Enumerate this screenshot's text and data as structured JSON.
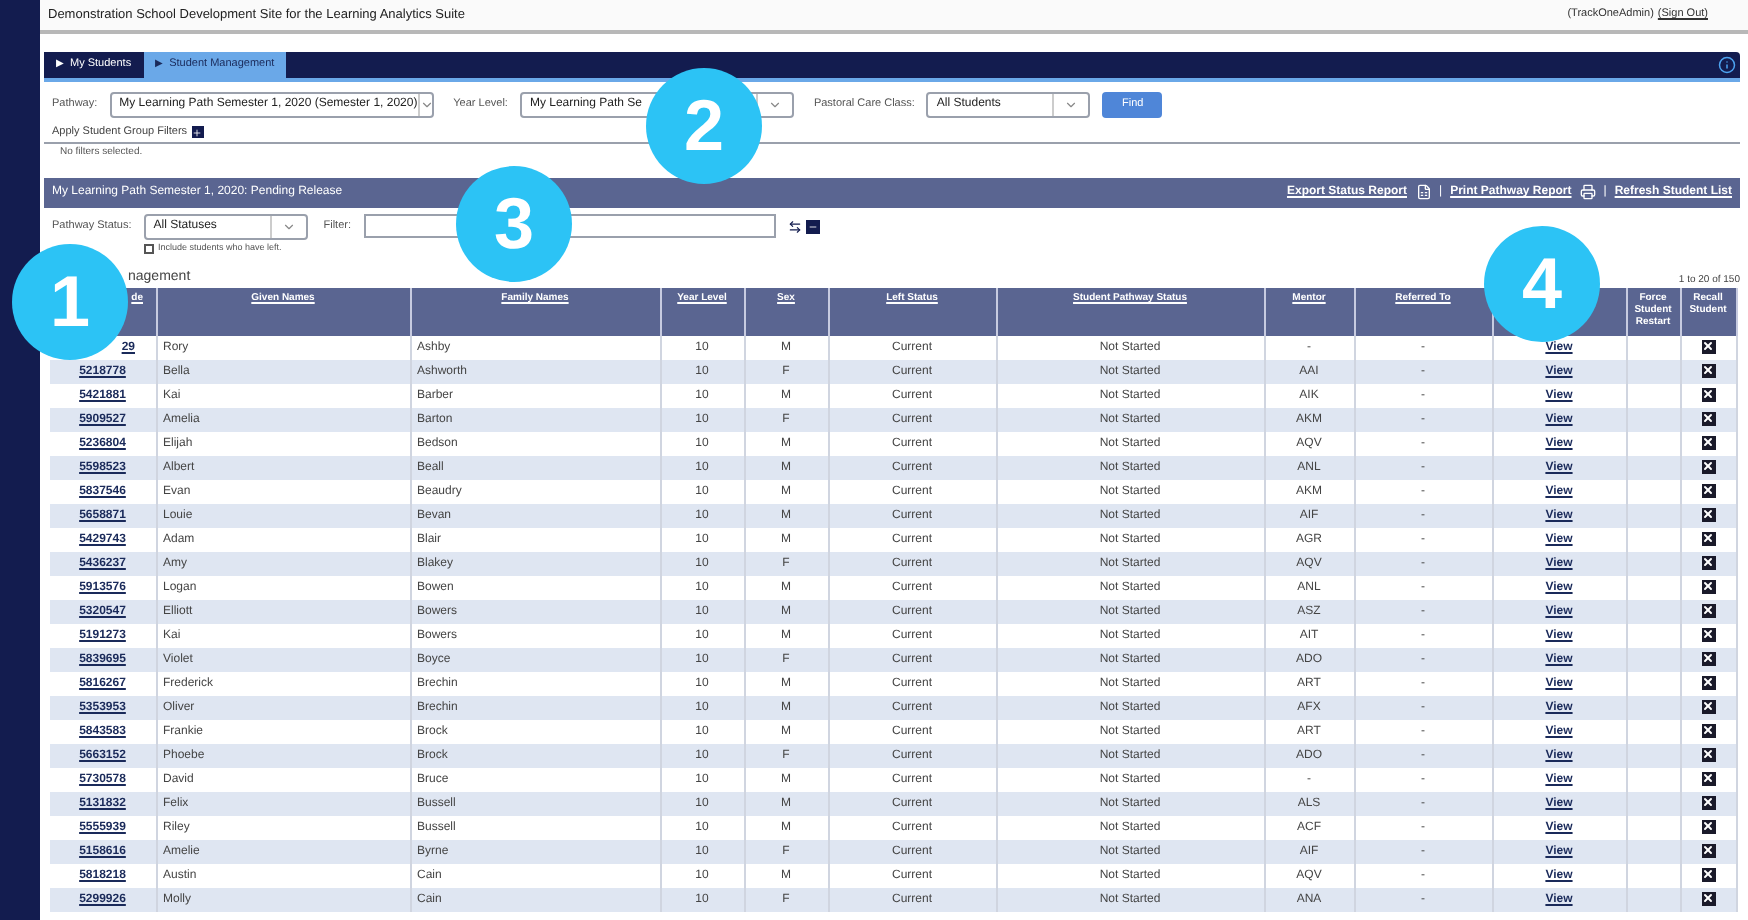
{
  "header": {
    "title": "Demonstration School Development Site for the Learning Analytics Suite",
    "user": "(TrackOneAdmin)",
    "sign_out": "(Sign Out)"
  },
  "tabs": [
    {
      "marker": "▶",
      "label": "My Students",
      "selected": false
    },
    {
      "marker": "▶",
      "label": "Student Management",
      "selected": true
    }
  ],
  "filters": {
    "pathway_label": "Pathway:",
    "pathway_value": "My Learning Path Semester 1, 2020 (Semester 1, 2020)",
    "year_label": "Year Level:",
    "year_value": "My Learning Path Se",
    "class_label": "Pastoral Care Class:",
    "class_value": "All Students",
    "find": "Find",
    "group_filters": "Apply Student Group Filters",
    "no_filters": "No filters selected."
  },
  "panel": {
    "title": "My Learning Path Semester 1, 2020: Pending Release",
    "links": [
      {
        "label": "Export Status Report",
        "kind": "export"
      },
      {
        "label": "Print Pathway Report",
        "kind": "print"
      },
      {
        "label": "Refresh Student List",
        "kind": "refresh"
      }
    ],
    "separator": "|"
  },
  "status": {
    "label": "Pathway Status:",
    "value": "All Statuses",
    "filter_label": "Filter:",
    "include_left": {
      "label": "Include students who have left.",
      "checked": false
    }
  },
  "section": {
    "heading": "nagement",
    "range": "1 to 20 of 150"
  },
  "table": {
    "columns": [
      {
        "label": "de"
      },
      {
        "label": "Given Names"
      },
      {
        "label": "Family Names"
      },
      {
        "label": "Year Level"
      },
      {
        "label": "Sex"
      },
      {
        "label": "Left Status"
      },
      {
        "label": "Student Pathway Status"
      },
      {
        "label": "Mentor"
      },
      {
        "label": "Referred To"
      },
      {},
      {
        "label": "Force Student Restart"
      },
      {
        "label": "Recall Student"
      }
    ],
    "rows": [
      {
        "code": "29",
        "given": "Rory",
        "family": "Ashby",
        "year": "10",
        "sex": "M",
        "left": "Current",
        "status": "Not Started",
        "mentor": "-",
        "referred": "-",
        "view": "View"
      },
      {
        "code": "5218778",
        "given": "Bella",
        "family": "Ashworth",
        "year": "10",
        "sex": "F",
        "left": "Current",
        "status": "Not Started",
        "mentor": "AAI",
        "referred": "-",
        "view": "View"
      },
      {
        "code": "5421881",
        "given": "Kai",
        "family": "Barber",
        "year": "10",
        "sex": "M",
        "left": "Current",
        "status": "Not Started",
        "mentor": "AIK",
        "referred": "-",
        "view": "View"
      },
      {
        "code": "5909527",
        "given": "Amelia",
        "family": "Barton",
        "year": "10",
        "sex": "F",
        "left": "Current",
        "status": "Not Started",
        "mentor": "AKM",
        "referred": "-",
        "view": "View"
      },
      {
        "code": "5236804",
        "given": "Elijah",
        "family": "Bedson",
        "year": "10",
        "sex": "M",
        "left": "Current",
        "status": "Not Started",
        "mentor": "AQV",
        "referred": "-",
        "view": "View"
      },
      {
        "code": "5598523",
        "given": "Albert",
        "family": "Beall",
        "year": "10",
        "sex": "M",
        "left": "Current",
        "status": "Not Started",
        "mentor": "ANL",
        "referred": "-",
        "view": "View"
      },
      {
        "code": "5837546",
        "given": "Evan",
        "family": "Beaudry",
        "year": "10",
        "sex": "M",
        "left": "Current",
        "status": "Not Started",
        "mentor": "AKM",
        "referred": "-",
        "view": "View"
      },
      {
        "code": "5658871",
        "given": "Louie",
        "family": "Bevan",
        "year": "10",
        "sex": "M",
        "left": "Current",
        "status": "Not Started",
        "mentor": "AIF",
        "referred": "-",
        "view": "View"
      },
      {
        "code": "5429743",
        "given": "Adam",
        "family": "Blair",
        "year": "10",
        "sex": "M",
        "left": "Current",
        "status": "Not Started",
        "mentor": "AGR",
        "referred": "-",
        "view": "View"
      },
      {
        "code": "5436237",
        "given": "Amy",
        "family": "Blakey",
        "year": "10",
        "sex": "F",
        "left": "Current",
        "status": "Not Started",
        "mentor": "AQV",
        "referred": "-",
        "view": "View"
      },
      {
        "code": "5913576",
        "given": "Logan",
        "family": "Bowen",
        "year": "10",
        "sex": "M",
        "left": "Current",
        "status": "Not Started",
        "mentor": "ANL",
        "referred": "-",
        "view": "View"
      },
      {
        "code": "5320547",
        "given": "Elliott",
        "family": "Bowers",
        "year": "10",
        "sex": "M",
        "left": "Current",
        "status": "Not Started",
        "mentor": "ASZ",
        "referred": "-",
        "view": "View"
      },
      {
        "code": "5191273",
        "given": "Kai",
        "family": "Bowers",
        "year": "10",
        "sex": "M",
        "left": "Current",
        "status": "Not Started",
        "mentor": "AIT",
        "referred": "-",
        "view": "View"
      },
      {
        "code": "5839695",
        "given": "Violet",
        "family": "Boyce",
        "year": "10",
        "sex": "F",
        "left": "Current",
        "status": "Not Started",
        "mentor": "ADO",
        "referred": "-",
        "view": "View"
      },
      {
        "code": "5816267",
        "given": "Frederick",
        "family": "Brechin",
        "year": "10",
        "sex": "M",
        "left": "Current",
        "status": "Not Started",
        "mentor": "ART",
        "referred": "-",
        "view": "View"
      },
      {
        "code": "5353953",
        "given": "Oliver",
        "family": "Brechin",
        "year": "10",
        "sex": "M",
        "left": "Current",
        "status": "Not Started",
        "mentor": "AFX",
        "referred": "-",
        "view": "View"
      },
      {
        "code": "5843583",
        "given": "Frankie",
        "family": "Brock",
        "year": "10",
        "sex": "M",
        "left": "Current",
        "status": "Not Started",
        "mentor": "ART",
        "referred": "-",
        "view": "View"
      },
      {
        "code": "5663152",
        "given": "Phoebe",
        "family": "Brock",
        "year": "10",
        "sex": "F",
        "left": "Current",
        "status": "Not Started",
        "mentor": "ADO",
        "referred": "-",
        "view": "View"
      },
      {
        "code": "5730578",
        "given": "David",
        "family": "Bruce",
        "year": "10",
        "sex": "M",
        "left": "Current",
        "status": "Not Started",
        "mentor": "-",
        "referred": "-",
        "view": "View"
      },
      {
        "code": "5131832",
        "given": "Felix",
        "family": "Bussell",
        "year": "10",
        "sex": "M",
        "left": "Current",
        "status": "Not Started",
        "mentor": "ALS",
        "referred": "-",
        "view": "View"
      },
      {
        "code": "5555939",
        "given": "Riley",
        "family": "Bussell",
        "year": "10",
        "sex": "M",
        "left": "Current",
        "status": "Not Started",
        "mentor": "ACF",
        "referred": "-",
        "view": "View"
      },
      {
        "code": "5158616",
        "given": "Amelie",
        "family": "Byrne",
        "year": "10",
        "sex": "F",
        "left": "Current",
        "status": "Not Started",
        "mentor": "AIF",
        "referred": "-",
        "view": "View"
      },
      {
        "code": "5818218",
        "given": "Austin",
        "family": "Cain",
        "year": "10",
        "sex": "M",
        "left": "Current",
        "status": "Not Started",
        "mentor": "AQV",
        "referred": "-",
        "view": "View"
      },
      {
        "code": "5299926",
        "given": "Molly",
        "family": "Cain",
        "year": "10",
        "sex": "F",
        "left": "Current",
        "status": "Not Started",
        "mentor": "ANA",
        "referred": "-",
        "view": "View"
      }
    ]
  },
  "callouts": [
    {
      "label": "1"
    },
    {
      "label": "2"
    },
    {
      "label": "3"
    },
    {
      "label": "4"
    }
  ]
}
